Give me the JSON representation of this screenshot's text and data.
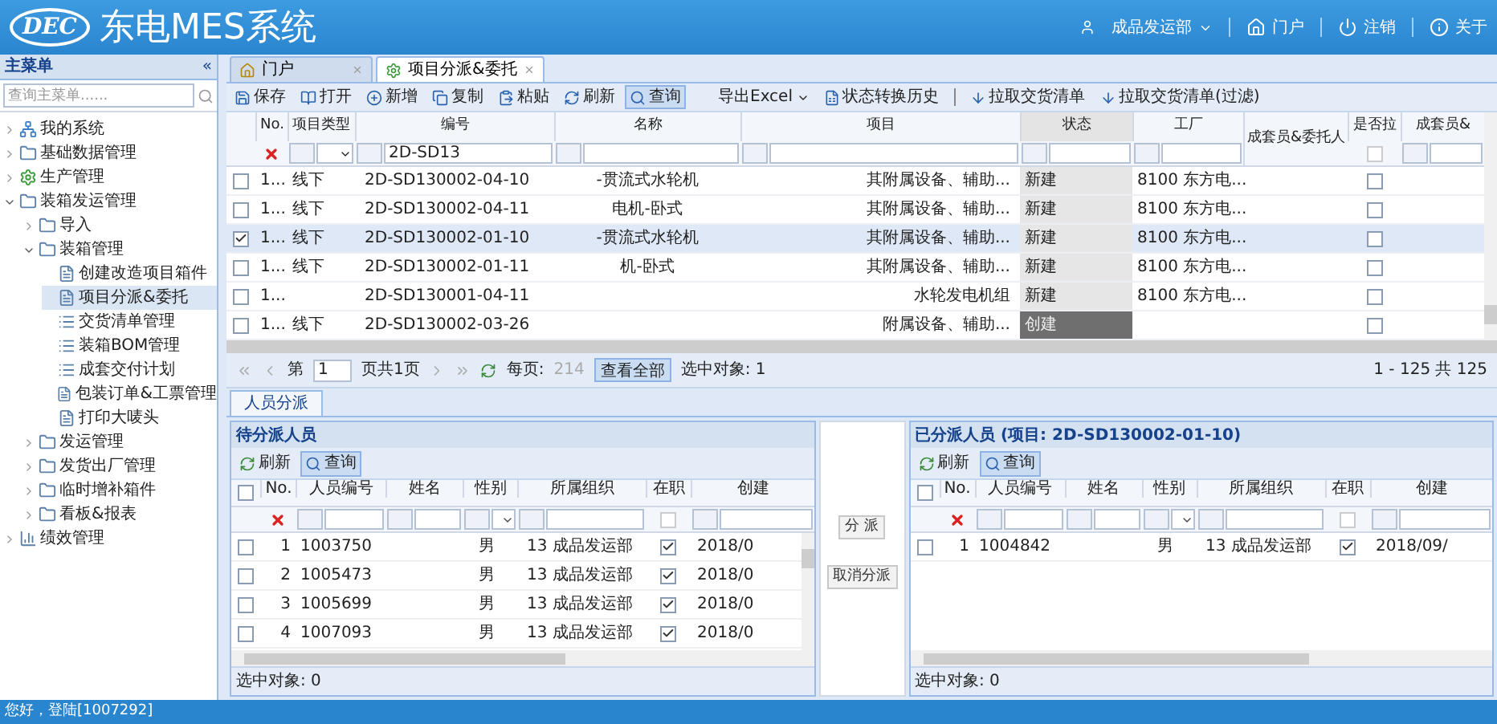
{
  "header": {
    "logo": "DEC",
    "title": "东电MES系统",
    "department": "成品发运部",
    "links": [
      {
        "label": "门户"
      },
      {
        "label": "注销"
      },
      {
        "label": "关于"
      }
    ]
  },
  "sidebar": {
    "title": "主菜单",
    "collapse": "«",
    "search": {
      "placeholder": "查询主菜单......"
    },
    "items": [
      {
        "label": "我的系统",
        "kind": "system",
        "expanded": false,
        "selected": false
      },
      {
        "label": "基础数据管理",
        "kind": "folder",
        "expanded": false,
        "selected": false
      },
      {
        "label": "生产管理",
        "kind": "gear",
        "expanded": false,
        "selected": false
      },
      {
        "label": "装箱发运管理",
        "kind": "folder",
        "expanded": true,
        "selected": false,
        "children": [
          {
            "label": "导入",
            "kind": "folder",
            "expanded": false,
            "selected": false
          },
          {
            "label": "装箱管理",
            "kind": "folder",
            "expanded": true,
            "selected": false,
            "children": [
              {
                "label": "创建改造项目箱件",
                "kind": "page",
                "selected": false
              },
              {
                "label": "项目分派&委托",
                "kind": "page",
                "selected": true
              },
              {
                "label": "交货清单管理",
                "kind": "list",
                "selected": false
              },
              {
                "label": "装箱BOM管理",
                "kind": "list",
                "selected": false
              },
              {
                "label": "成套交付计划",
                "kind": "list",
                "selected": false
              },
              {
                "label": "包装订单&工票管理",
                "kind": "page",
                "selected": false
              },
              {
                "label": "打印大唛头",
                "kind": "page",
                "selected": false
              }
            ]
          },
          {
            "label": "发运管理",
            "kind": "folder",
            "expanded": false,
            "selected": false
          },
          {
            "label": "发货出厂管理",
            "kind": "folder",
            "expanded": false,
            "selected": false
          },
          {
            "label": "临时增补箱件",
            "kind": "folder",
            "expanded": false,
            "selected": false
          },
          {
            "label": "看板&报表",
            "kind": "folder",
            "expanded": false,
            "selected": false
          }
        ]
      },
      {
        "label": "绩效管理",
        "kind": "report",
        "expanded": false,
        "selected": false
      }
    ]
  },
  "tabs": [
    {
      "label": "门户",
      "selected": false
    },
    {
      "label": "项目分派&委托",
      "selected": true
    }
  ],
  "toolbar": [
    {
      "kind": "button",
      "label": "保存",
      "selected": false
    },
    {
      "kind": "button",
      "label": "打开",
      "selected": false
    },
    {
      "kind": "button",
      "label": "新增",
      "selected": false
    },
    {
      "kind": "button",
      "label": "复制",
      "selected": false
    },
    {
      "kind": "button",
      "label": "粘贴",
      "selected": false
    },
    {
      "kind": "button",
      "label": "刷新",
      "selected": false
    },
    {
      "kind": "button",
      "label": "查询",
      "selected": true
    },
    {
      "kind": "dropdown",
      "label": "导出Excel",
      "selected": false
    },
    {
      "kind": "button",
      "label": "状态转换历史",
      "selected": false
    },
    {
      "kind": "separator"
    },
    {
      "kind": "button",
      "label": "拉取交货清单",
      "selected": false
    },
    {
      "kind": "button",
      "label": "拉取交货清单(过滤)",
      "selected": false
    }
  ],
  "table": {
    "columns": [
      {
        "label": "No.",
        "kind": "clear"
      },
      {
        "label": "项目类型",
        "kind": "select"
      },
      {
        "label": "编号",
        "kind": "text",
        "filter_value": "2D-SD13"
      },
      {
        "label": "名称",
        "kind": "text"
      },
      {
        "label": "项目",
        "kind": "text"
      },
      {
        "label": "状态",
        "kind": "text"
      },
      {
        "label": "工厂",
        "kind": "text"
      },
      {
        "label": "成套员&委托人",
        "kind": "none"
      },
      {
        "label": "是否拉",
        "kind": "check",
        "filter_checked": false
      },
      {
        "label": "成套员&",
        "kind": "text"
      }
    ],
    "rows": [
      {
        "no": "1...",
        "type": "线下",
        "code": "2D-SD130002-04-10",
        "name": "-贯流式水轮机",
        "project": "其附属设备、辅助...",
        "status": "新建",
        "status_highlighted": false,
        "factory": "8100 东方电...",
        "pulled": false,
        "selected": false
      },
      {
        "no": "1...",
        "type": "线下",
        "code": "2D-SD130002-04-11",
        "name": "电机-卧式",
        "project": "其附属设备、辅助...",
        "status": "新建",
        "status_highlighted": false,
        "factory": "8100 东方电...",
        "pulled": false,
        "selected": false
      },
      {
        "no": "1...",
        "type": "线下",
        "code": "2D-SD130002-01-10",
        "name": "-贯流式水轮机",
        "project": "其附属设备、辅助...",
        "status": "新建",
        "status_highlighted": false,
        "factory": "8100 东方电...",
        "pulled": false,
        "selected": true
      },
      {
        "no": "1...",
        "type": "线下",
        "code": "2D-SD130002-01-11",
        "name": "机-卧式",
        "project": "其附属设备、辅助...",
        "status": "新建",
        "status_highlighted": false,
        "factory": "8100 东方电...",
        "pulled": false,
        "selected": false
      },
      {
        "no": "1...",
        "code": "2D-SD130001-04-11",
        "project": "水轮发电机组",
        "status": "新建",
        "status_highlighted": false,
        "factory": "8100 东方电...",
        "pulled": false,
        "selected": false
      },
      {
        "no": "1...",
        "type": "线下",
        "code": "2D-SD130002-03-26",
        "project": "附属设备、辅助...",
        "status": "创建",
        "status_highlighted": true,
        "pulled": false,
        "selected": false
      }
    ]
  },
  "pager": {
    "page_prefix": "第",
    "page": "1",
    "page_suffix": "页共1页",
    "per_page_label": "每页:",
    "per_page": "214",
    "view_all": "查看全部",
    "selected_count": "选中对象: 1",
    "range": "1 - 125 共 125"
  },
  "lower_tabs": [
    {
      "label": "人员分派",
      "selected": true
    }
  ],
  "panels": [
    {
      "title": "待分派人员",
      "toolbar": [
        {
          "label": "刷新",
          "selected": false
        },
        {
          "label": "查询",
          "selected": true
        }
      ],
      "all_selected": false,
      "active_filter_checked": false,
      "columns": [
        "No.",
        "人员编号",
        "姓名",
        "性别",
        "所属组织",
        "在职",
        "创建"
      ],
      "rows": [
        {
          "no": "1",
          "id": "1003750",
          "gender": "男",
          "org": "13 成品发运部",
          "active": true,
          "created": "2018/0",
          "selected": false
        },
        {
          "no": "2",
          "id": "1005473",
          "gender": "男",
          "org": "13 成品发运部",
          "active": true,
          "created": "2018/0",
          "selected": false
        },
        {
          "no": "3",
          "id": "1005699",
          "gender": "男",
          "org": "13 成品发运部",
          "active": true,
          "created": "2018/0",
          "selected": false
        },
        {
          "no": "4",
          "id": "1007093",
          "gender": "男",
          "org": "13 成品发运部",
          "active": true,
          "created": "2018/0",
          "selected": false
        }
      ],
      "footer": "选中对象: 0"
    },
    {
      "title": "已分派人员 (项目: 2D-SD130002-01-10)",
      "toolbar": [
        {
          "label": "刷新",
          "selected": false
        },
        {
          "label": "查询",
          "selected": true
        }
      ],
      "all_selected": false,
      "active_filter_checked": false,
      "columns": [
        "No.",
        "人员编号",
        "姓名",
        "性别",
        "所属组织",
        "在职",
        "创建"
      ],
      "rows": [
        {
          "no": "1",
          "id": "1004842",
          "gender": "男",
          "org": "13 成品发运部",
          "active": true,
          "created": "2018/09/",
          "selected": false
        }
      ],
      "footer": "选中对象: 0"
    }
  ],
  "assign_buttons": [
    {
      "label": "分 派"
    },
    {
      "label": "取消分派"
    }
  ],
  "status_bar": {
    "text": "您好，登陆[1007292]"
  }
}
